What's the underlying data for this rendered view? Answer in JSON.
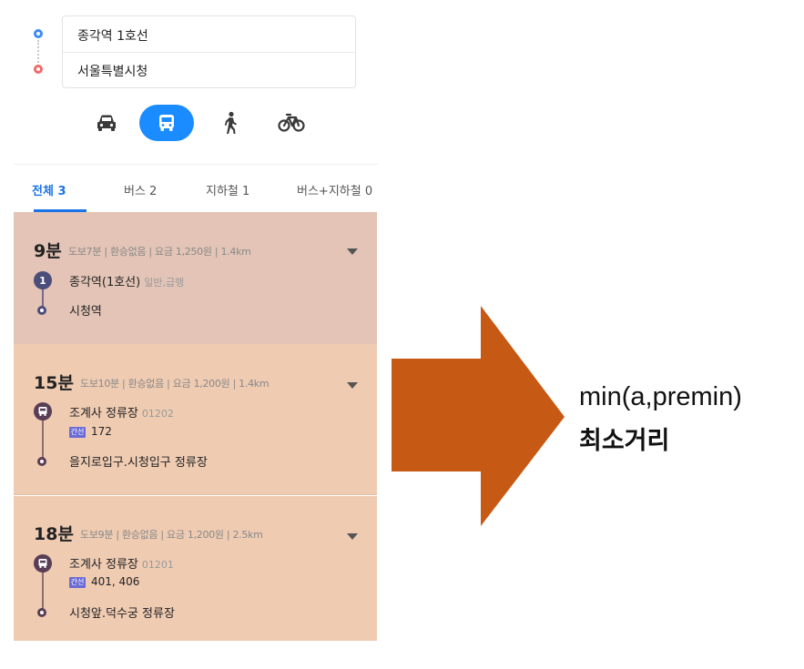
{
  "search": {
    "origin": "종각역 1호선",
    "destination": "서울특별시청"
  },
  "modes": [
    "car",
    "bus",
    "walk",
    "bicycle"
  ],
  "tabs": [
    {
      "label": "전체 3"
    },
    {
      "label": "버스 2"
    },
    {
      "label": "지하철 1"
    },
    {
      "label": "버스+지하철 0"
    }
  ],
  "routes": [
    {
      "time": "9분",
      "meta": "도보7분 | 환승없음 | 요금 1,250원 | 1.4km",
      "line_badge": "1",
      "board_stop": "종각역(1호선)",
      "board_sub": "일반,급행",
      "alight_stop": "시청역"
    },
    {
      "time": "15분",
      "meta": "도보10분 | 환승없음 | 요금 1,200원 | 1.4km",
      "board_stop": "조계사 정류장",
      "board_sub": "01202",
      "bus_tag": "간선",
      "bus_no": "172",
      "alight_stop": "을지로입구.시청입구 정류장"
    },
    {
      "time": "18분",
      "meta": "도보9분 | 환승없음 | 요금 1,200원 | 2.5km",
      "board_stop": "조계사 정류장",
      "board_sub": "01201",
      "bus_tag": "간선",
      "bus_no": "401, 406",
      "alight_stop": "시청앞.덕수궁 정류장"
    }
  ],
  "annotation": {
    "line1": "min(a,premin)",
    "line2": "최소거리"
  },
  "colors": {
    "accent": "#1a8cff",
    "arrow": "#c65a14",
    "card_selected": "#e3c4b6",
    "card": "#efcbb2"
  }
}
